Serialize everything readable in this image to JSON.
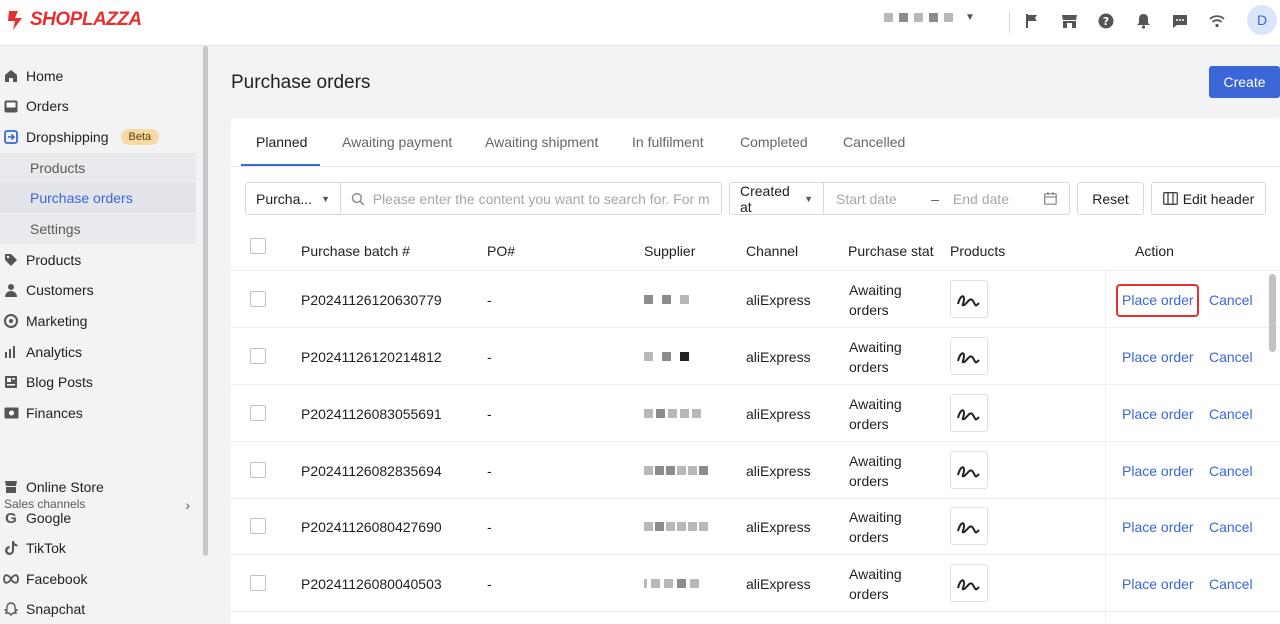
{
  "brand": {
    "name": "SHOPLAZZA"
  },
  "topbar": {
    "avatar_letter": "D"
  },
  "sidebar": {
    "items": [
      {
        "label": "Home",
        "icon": "home-icon"
      },
      {
        "label": "Orders",
        "icon": "orders-icon"
      },
      {
        "label": "Dropshipping",
        "icon": "dropshipping-icon",
        "badge": "Beta"
      },
      {
        "label": "Products",
        "sub": true
      },
      {
        "label": "Purchase orders",
        "sub": true,
        "active": true
      },
      {
        "label": "Settings",
        "sub": true
      },
      {
        "label": "Products",
        "icon": "tag-icon"
      },
      {
        "label": "Customers",
        "icon": "person-icon"
      },
      {
        "label": "Marketing",
        "icon": "marketing-icon"
      },
      {
        "label": "Analytics",
        "icon": "analytics-icon"
      },
      {
        "label": "Blog Posts",
        "icon": "blog-icon"
      },
      {
        "label": "Finances",
        "icon": "finances-icon"
      }
    ],
    "sales_channels_title": "Sales channels",
    "channels": [
      {
        "label": "Online Store",
        "icon": "store-icon"
      },
      {
        "label": "Google",
        "icon": "google-icon"
      },
      {
        "label": "TikTok",
        "icon": "tiktok-icon"
      },
      {
        "label": "Facebook",
        "icon": "meta-icon"
      },
      {
        "label": "Snapchat",
        "icon": "snapchat-icon"
      }
    ]
  },
  "page": {
    "title": "Purchase orders",
    "create_label": "Create"
  },
  "tabs": [
    "Planned",
    "Awaiting payment",
    "Awaiting shipment",
    "In fulfilment",
    "Completed",
    "Cancelled"
  ],
  "filters": {
    "field_select": "Purcha...",
    "search_placeholder": "Please enter the content you want to search for. For m...",
    "date_field": "Created at",
    "start_placeholder": "Start date",
    "range_sep": "–",
    "end_placeholder": "End date",
    "reset_label": "Reset",
    "edit_header_label": "Edit header"
  },
  "table": {
    "headers": {
      "batch": "Purchase batch #",
      "po": "PO#",
      "supplier": "Supplier",
      "channel": "Channel",
      "status": "Purchase stat",
      "products": "Products",
      "action": "Action"
    },
    "rows": [
      {
        "batch": "P20241126120630779",
        "po": "-",
        "channel": "aliExpress",
        "status_line1": "Awaiting",
        "status_line2": "orders",
        "place": "Place order",
        "cancel": "Cancel"
      },
      {
        "batch": "P20241126120214812",
        "po": "-",
        "channel": "aliExpress",
        "status_line1": "Awaiting",
        "status_line2": "orders",
        "place": "Place order",
        "cancel": "Cancel"
      },
      {
        "batch": "P20241126083055691",
        "po": "-",
        "channel": "aliExpress",
        "status_line1": "Awaiting",
        "status_line2": "orders",
        "place": "Place order",
        "cancel": "Cancel"
      },
      {
        "batch": "P20241126082835694",
        "po": "-",
        "channel": "aliExpress",
        "status_line1": "Awaiting",
        "status_line2": "orders",
        "place": "Place order",
        "cancel": "Cancel"
      },
      {
        "batch": "P20241126080427690",
        "po": "-",
        "channel": "aliExpress",
        "status_line1": "Awaiting",
        "status_line2": "orders",
        "place": "Place order",
        "cancel": "Cancel"
      },
      {
        "batch": "P20241126080040503",
        "po": "-",
        "channel": "aliExpress",
        "status_line1": "Awaiting",
        "status_line2": "orders",
        "place": "Place order",
        "cancel": "Cancel"
      }
    ]
  },
  "colors": {
    "accent": "#3a66d8",
    "brand": "#e5312f",
    "highlight": "#e5312f"
  }
}
